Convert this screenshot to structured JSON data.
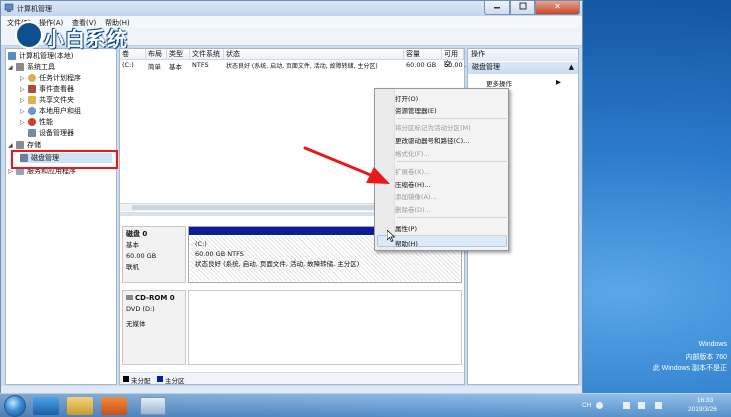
{
  "window": {
    "title": "计算机管理",
    "controls": {
      "close": "✕"
    }
  },
  "menu": [
    "文件(F)",
    "操作(A)",
    "查看(V)",
    "帮助(H)"
  ],
  "watermark": "小白系统",
  "tree": {
    "root": "计算机管理(本地)",
    "system_tools": "系统工具",
    "task_scheduler": "任务计划程序",
    "event_viewer": "事件查看器",
    "shared_folders": "共享文件夹",
    "local_users": "本地用户和组",
    "performance": "性能",
    "device_manager": "设备管理器",
    "storage": "存储",
    "disk_management": "磁盘管理",
    "services_apps": "服务和应用程序"
  },
  "volume_table": {
    "headers": [
      "卷",
      "布局",
      "类型",
      "文件系统",
      "状态",
      "容量",
      "可用空"
    ],
    "rows": [
      {
        "volume": "(C:)",
        "layout": "简单",
        "type": "基本",
        "fs": "NTFS",
        "status": "状态良好 (系统, 启动, 页面文件, 活动, 故障转储, 主分区)",
        "capacity": "60.00 GB",
        "free": "60.00 ..."
      }
    ]
  },
  "disks": {
    "disk0": {
      "title": "磁盘 0",
      "type": "基本",
      "size": "60.00 GB",
      "status": "联机"
    },
    "cdrom0": {
      "title": "CD-ROM 0",
      "drive": "DVD (D:)",
      "status": "无媒体"
    },
    "partition": {
      "name": "(C:)",
      "size_fs": "60.00 GB NTFS",
      "status": "状态良好 (系统, 启动, 页面文件, 活动, 故障转储, 主分区)"
    }
  },
  "legend": {
    "unallocated": "未分配",
    "primary": "主分区"
  },
  "actions": {
    "header": "操作",
    "section": "磁盘管理",
    "more": "更多操作"
  },
  "context_menu": {
    "items": [
      {
        "label": "打开(O)",
        "enabled": true
      },
      {
        "label": "资源管理器(E)",
        "enabled": true
      },
      {
        "label": "将分区标记为活动分区(M)",
        "enabled": false
      },
      {
        "label": "更改驱动器号和路径(C)...",
        "enabled": true
      },
      {
        "label": "格式化(F)...",
        "enabled": false
      },
      {
        "label": "扩展卷(X)...",
        "enabled": false
      },
      {
        "label": "压缩卷(H)...",
        "enabled": true
      },
      {
        "label": "添加镜像(A)...",
        "enabled": false
      },
      {
        "label": "删除卷(D)...",
        "enabled": false
      },
      {
        "label": "属性(P)",
        "enabled": true
      },
      {
        "label": "帮助(H)",
        "enabled": true
      }
    ]
  },
  "desktop": {
    "line1": "Windows",
    "line2": "内部版本 760",
    "line3": "此 Windows 副本不是正"
  },
  "taskbar": {
    "lang": "CH",
    "time": "16:33",
    "date": "2019/3/26"
  },
  "colors": {
    "accent": "#0d1d9a",
    "highlight": "#e8191d",
    "arrow": "#e8191d"
  }
}
